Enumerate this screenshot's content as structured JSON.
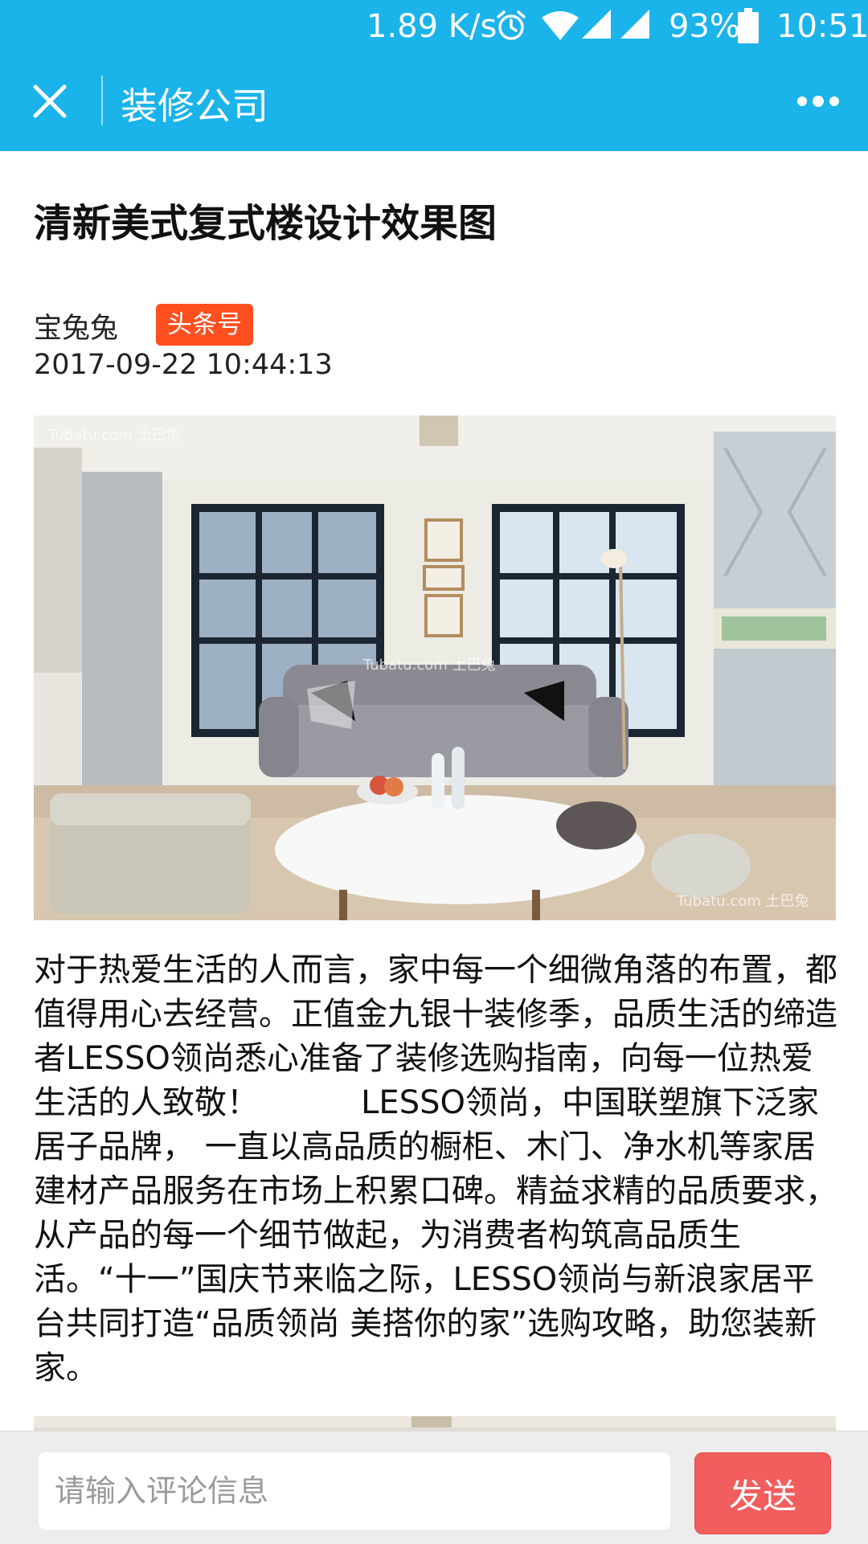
{
  "status_bar": {
    "network_speed": "1.89 K/s",
    "battery_percent": "93%",
    "time": "10:51",
    "icons": [
      "alarm-icon",
      "wifi-icon",
      "signal-icon",
      "signal-icon",
      "battery-icon"
    ]
  },
  "titlebar": {
    "title": "装修公司",
    "close_icon": "close-icon",
    "more_icon": "more-icon"
  },
  "article": {
    "headline": "清新美式复式楼设计效果图",
    "author": "宝兔兔",
    "badge": "头条号",
    "datetime": "2017-09-22 10:44:13",
    "photo_watermarks": [
      "Tubatu.com 土巴兔",
      "Tubatu.com 土巴兔",
      "Tubatu.com 土巴兔"
    ],
    "body": "对于热爱生活的人而言，家中每一个细微角落的布置，都值得用心去经营。正值金九银十装修季，品质生活的缔造者LESSO领尚悉心准备了装修选购指南，向每一位热爱生活的人致敬！          LESSO领尚，中国联塑旗下泛家居子品牌， 一直以高品质的橱柜、木门、净水机等家居建材产品服务在市场上积累口碑。精益求精的品质要求，从产品的每一个细节做起，为消费者构筑高品质生活。“十一”国庆节来临之际，LESSO领尚与新浪家居平台共同打造“品质领尚 美搭你的家”选购攻略，助您装新家。"
  },
  "comment": {
    "placeholder": "请输入评论信息",
    "value": "",
    "send_label": "发送"
  },
  "colors": {
    "header_blue": "#1ab3ea",
    "badge_orange": "#ff4f1f",
    "send_red": "#f25d5d",
    "comment_bar_bg": "#ededed"
  }
}
